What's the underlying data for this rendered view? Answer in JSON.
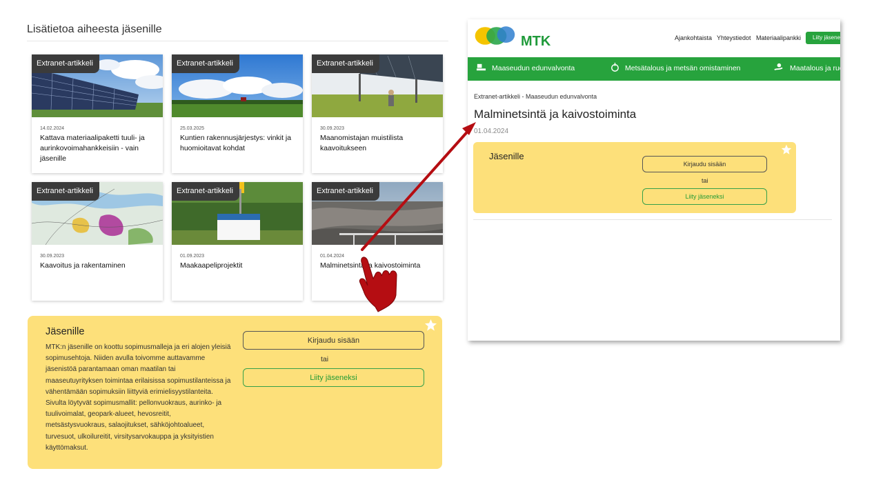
{
  "section": {
    "title": "Lisätietoa aiheesta jäsenille"
  },
  "cards": [
    {
      "tag": "Extranet-artikkeli",
      "date": "14.02.2024",
      "title": "Kattava materiaalipaketti tuuli- ja aurinkovoimahankkeisiin - vain jäsenille"
    },
    {
      "tag": "Extranet-artikkeli",
      "date": "25.03.2025",
      "title": "Kuntien rakennusjärjestys: vinkit ja huomioitavat kohdat"
    },
    {
      "tag": "Extranet-artikkeli",
      "date": "30.09.2023",
      "title": "Maanomistajan muistilista kaavoitukseen"
    },
    {
      "tag": "Extranet-artikkeli",
      "date": "30.09.2023",
      "title": "Kaavoitus ja rakentaminen"
    },
    {
      "tag": "Extranet-artikkeli",
      "date": "01.09.2023",
      "title": "Maakaapeliprojektit"
    },
    {
      "tag": "Extranet-artikkeli",
      "date": "01.04.2024",
      "title": "Malminetsintä ja kaivostoiminta"
    }
  ],
  "members_box": {
    "title": "Jäsenille",
    "text": "MTK:n jäsenille on koottu sopimusmalleja ja eri alojen yleisiä sopimusehtoja. Niiden avulla toivomme auttavamme jäsenistöä parantamaan oman maatilan tai maaseutuyrityksen toimintaa erilaisissa sopimustilanteissa ja vähentämään sopimuksiin liittyviä erimielisyystilanteita. Sivulta löytyvät sopimusmallit: pellonvuokraus, aurinko- ja tuulivoimalat, geopark-alueet, hevosreitit, metsästysvuokraus, salaojitukset, sähköjohtoalueet, turvesuot, ulkoilureitit, virsitysarvokauppa ja yksityistien käyttömaksut.",
    "login_label": "Kirjaudu sisään",
    "or_label": "tai",
    "join_label": "Liity jäseneksi"
  },
  "screenshot": {
    "logo_text": "MTK",
    "topnav": [
      "Ajankohtaista",
      "Yhteystiedot",
      "Materiaalipankki"
    ],
    "cta_label": "Liity jäseneksi",
    "mainnav": [
      "Maaseudun edunvalvonta",
      "Metsätalous ja metsän omistaminen",
      "Maatalous ja ruoantuotanto"
    ],
    "breadcrumb": "Extranet-artikkeli - Maaseudun edunvalvonta",
    "article_title": "Malminetsintä ja kaivostoiminta",
    "article_date": "01.04.2024",
    "box": {
      "title": "Jäsenille",
      "login_label": "Kirjaudu sisään",
      "or_label": "tai",
      "join_label": "Liity jäseneksi"
    }
  },
  "colors": {
    "brand_green": "#27a33d",
    "members_yellow": "#fde07a",
    "tag_dark": "#3b3b3b",
    "arrow_red": "#b50d12"
  }
}
